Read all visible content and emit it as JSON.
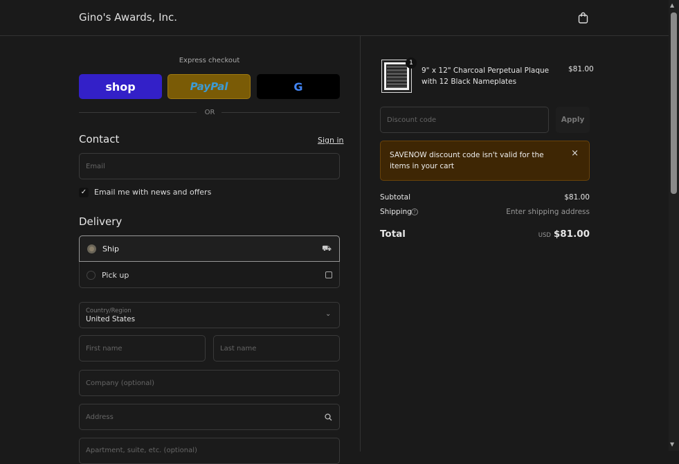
{
  "header": {
    "brand": "Gino's Awards, Inc.",
    "cart_icon": "shopping-bag-icon"
  },
  "express": {
    "label": "Express checkout",
    "shop": "shop",
    "paypal": "PayPal",
    "google": "G",
    "or": "OR"
  },
  "contact": {
    "title": "Contact",
    "sign_in": "Sign in",
    "email_placeholder": "Email",
    "newsletter": "Email me with news and offers",
    "newsletter_checked": true
  },
  "delivery": {
    "title": "Delivery",
    "options": [
      {
        "label": "Ship",
        "selected": true,
        "icon": "truck-icon"
      },
      {
        "label": "Pick up",
        "selected": false,
        "icon": "store-icon"
      }
    ],
    "country_label": "Country/Region",
    "country_value": "United States",
    "first_name": "First name",
    "last_name": "Last name",
    "company": "Company (optional)",
    "address": "Address",
    "apartment": "Apartment, suite, etc. (optional)"
  },
  "summary": {
    "item": {
      "name": "9\" x 12\" Charcoal Perpetual Plaque with 12 Black Nameplates",
      "price": "$81.00",
      "qty": "1"
    },
    "discount_placeholder": "Discount code",
    "apply": "Apply",
    "error_code": "SAVENOW",
    "error_text": " discount code isn't valid for the items in your cart",
    "subtotal_label": "Subtotal",
    "subtotal": "$81.00",
    "shipping_label": "Shipping",
    "shipping": "Enter shipping address",
    "total_label": "Total",
    "currency": "USD",
    "total": "$81.00"
  }
}
